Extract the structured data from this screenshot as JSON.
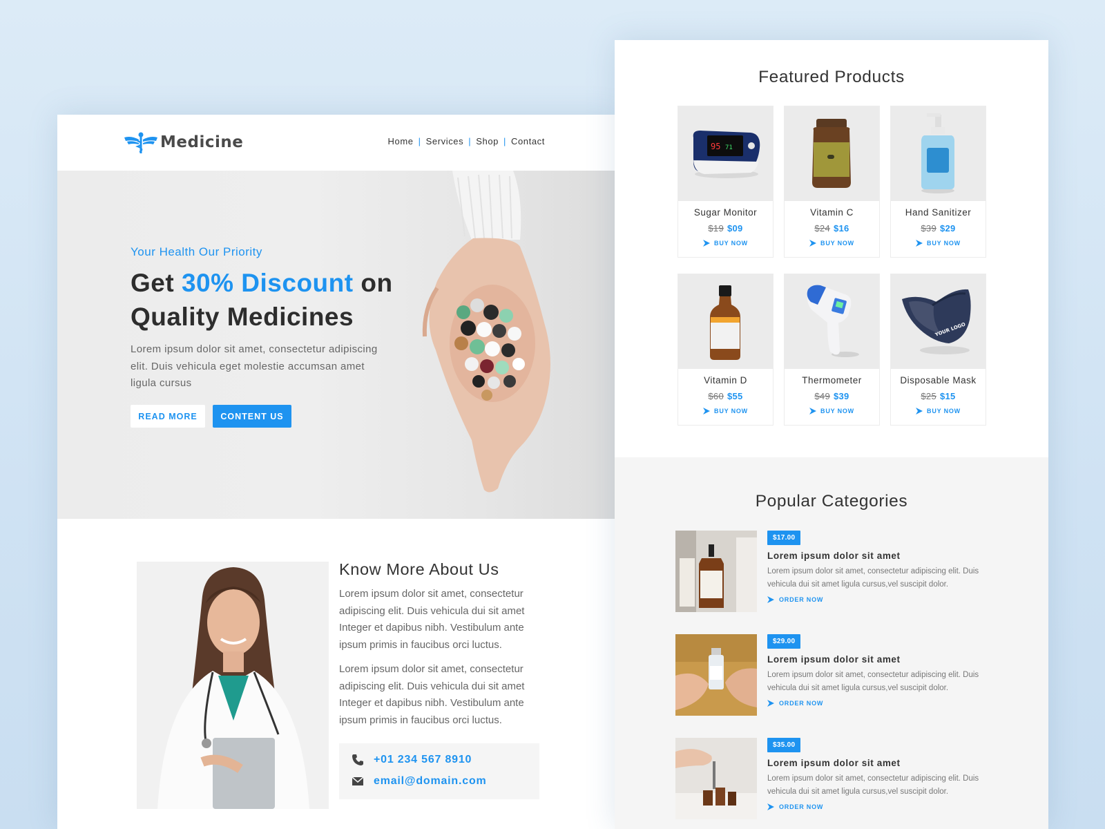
{
  "brand": {
    "name": "Medicine",
    "accent": "#1e93f0",
    "icon": "caduceus-icon"
  },
  "nav": {
    "items": [
      "Home",
      "Services",
      "Shop",
      "Contact"
    ],
    "separator": "|"
  },
  "hero": {
    "tagline": "Your Health Our Priority",
    "headline_pre": "Get ",
    "headline_accent": "30% Discount",
    "headline_post": " on",
    "headline_line2": "Quality Medicines",
    "description": "Lorem ipsum dolor sit amet, consectetur adipiscing elit. Duis vehicula eget molestie accumsan amet ligula cursus",
    "read_more": "READ MORE",
    "contact_us": "CONTENT US"
  },
  "about": {
    "title": "Know More About Us",
    "para1": "Lorem ipsum dolor sit amet, consectetur adipiscing elit. Duis vehicula dui sit amet Integer et dapibus nibh. Vestibulum ante ipsum primis in faucibus orci luctus.",
    "para2": "Lorem ipsum dolor sit amet, consectetur adipiscing elit. Duis vehicula dui sit amet Integer et dapibus nibh. Vestibulum ante ipsum primis in faucibus orci luctus.",
    "phone": "+01 234 567 8910",
    "email": "email@domain.com"
  },
  "featured": {
    "title": "Featured Products",
    "buy_label": "BUY NOW",
    "products": [
      {
        "name": "Sugar Monitor",
        "old": "$19",
        "new": "$09"
      },
      {
        "name": "Vitamin C",
        "old": "$24",
        "new": "$16"
      },
      {
        "name": "Hand Sanitizer",
        "old": "$39",
        "new": "$29"
      },
      {
        "name": "Vitamin D",
        "old": "$60",
        "new": "$55"
      },
      {
        "name": "Thermometer",
        "old": "$49",
        "new": "$39"
      },
      {
        "name": "Disposable Mask",
        "old": "$25",
        "new": "$15"
      }
    ]
  },
  "categories": {
    "title": "Popular Categories",
    "order_label": "ORDER NOW",
    "items": [
      {
        "price": "$17.00",
        "title": "Lorem ipsum dolor sit amet",
        "text": "Lorem ipsum dolor sit amet, consectetur adipiscing elit. Duis vehicula dui sit amet ligula cursus,vel suscipit dolor."
      },
      {
        "price": "$29.00",
        "title": "Lorem ipsum dolor sit amet",
        "text": "Lorem ipsum dolor sit amet, consectetur adipiscing elit. Duis vehicula dui sit amet ligula cursus,vel suscipit dolor."
      },
      {
        "price": "$35.00",
        "title": "Lorem ipsum dolor sit amet",
        "text": "Lorem ipsum dolor sit amet, consectetur adipiscing elit. Duis vehicula dui sit amet ligula cursus,vel suscipit dolor."
      }
    ]
  }
}
